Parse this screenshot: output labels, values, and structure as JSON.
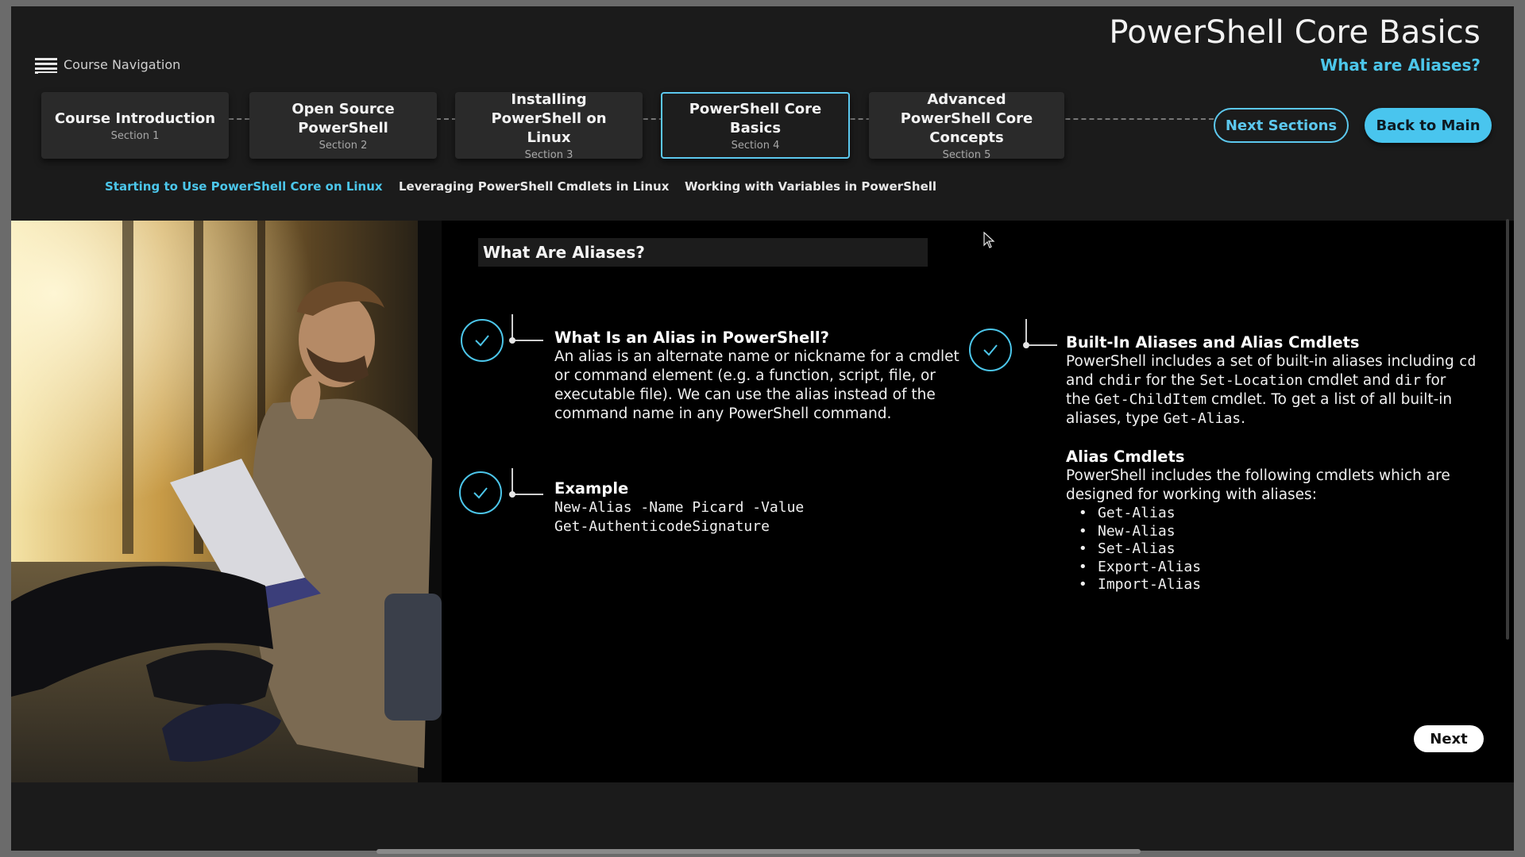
{
  "header": {
    "course_title": "PowerShell Core Basics",
    "page_subtitle": "What are Aliases?",
    "nav_toggle_label": "Course Navigation"
  },
  "steps": [
    {
      "title": "Course Introduction",
      "section": "Section 1",
      "active": false
    },
    {
      "title": "Open Source PowerShell",
      "section": "Section 2",
      "active": false
    },
    {
      "title": "Installing PowerShell on Linux",
      "section": "Section 3",
      "active": false
    },
    {
      "title": "PowerShell Core Basics",
      "section": "Section 4",
      "active": true
    },
    {
      "title": "Advanced PowerShell Core Concepts",
      "section": "Section 5",
      "active": false
    }
  ],
  "buttons": {
    "next_sections": "Next Sections",
    "back_to_main": "Back to Main",
    "next": "Next"
  },
  "subtopics": [
    {
      "label": "Starting to Use PowerShell Core on Linux",
      "active": true
    },
    {
      "label": "Leveraging PowerShell Cmdlets in Linux",
      "active": false
    },
    {
      "label": "Working with Variables in PowerShell",
      "active": false
    }
  ],
  "main": {
    "heading": "What Are Aliases?",
    "left_items": [
      {
        "title": "What Is an Alias in PowerShell?",
        "lines": [
          "An alias is an alternate name or nickname for a cmdlet",
          "or command element (e.g. a function, script, file, or",
          "executable file). We can use the alias instead of the",
          "command name in any PowerShell command."
        ]
      },
      {
        "title": "Example",
        "code_lines": [
          "New-Alias -Name Picard -Value",
          "Get-AuthenticodeSignature"
        ]
      }
    ],
    "right_item": {
      "title": "Built-In Aliases and Alias Cmdlets",
      "p1": {
        "t1": "PowerShell includes a set of built-in aliases including ",
        "c1": "cd",
        "t2": "and ",
        "c2": "chdir",
        "t3": " for the ",
        "c3": "Set-Location",
        "t4": " cmdlet and ",
        "c4": "dir",
        "t5": " for",
        "t6": "the ",
        "c5": "Get-ChildItem",
        "t7": " cmdlet. To get a list of all built-in",
        "t8": "aliases, type ",
        "c6": "Get-Alias",
        "t9": "."
      },
      "subtitle": "Alias Cmdlets",
      "p2_lines": [
        "PowerShell includes the following cmdlets which are",
        "designed for working with aliases:"
      ],
      "cmdlets": [
        "Get-Alias",
        "New-Alias",
        "Set-Alias",
        "Export-Alias",
        "Import-Alias"
      ]
    }
  },
  "colors": {
    "accent": "#4cc6ea",
    "background": "#1b1b1b",
    "content_bg": "#000000"
  },
  "icons": {
    "nav": "list-icon",
    "check": "check-icon",
    "cursor": "mouse-pointer-icon"
  }
}
